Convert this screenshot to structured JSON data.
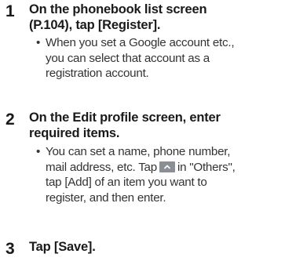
{
  "steps": [
    {
      "number": "1",
      "title_line1": "On the phonebook list screen",
      "title_line2": "(P.104), tap [Register].",
      "bullet_marker": "•",
      "bullet_line1": "When you set a Google account etc.,",
      "bullet_line2": "you can select that account as a",
      "bullet_line3": "registration account."
    },
    {
      "number": "2",
      "title_line1": "On the Edit profile screen, enter",
      "title_line2": "required items.",
      "bullet_marker": "•",
      "bullet_line1": "You can set a name, phone number,",
      "bullet_line2_pre": "mail address, etc. Tap",
      "bullet_line2_post": "in \"Others\",",
      "bullet_line3": "tap [Add] of an item you want to",
      "bullet_line4": "register, and then enter.",
      "icon": "expand-up-icon"
    },
    {
      "number": "3",
      "title_line1": "Tap [Save]."
    }
  ]
}
